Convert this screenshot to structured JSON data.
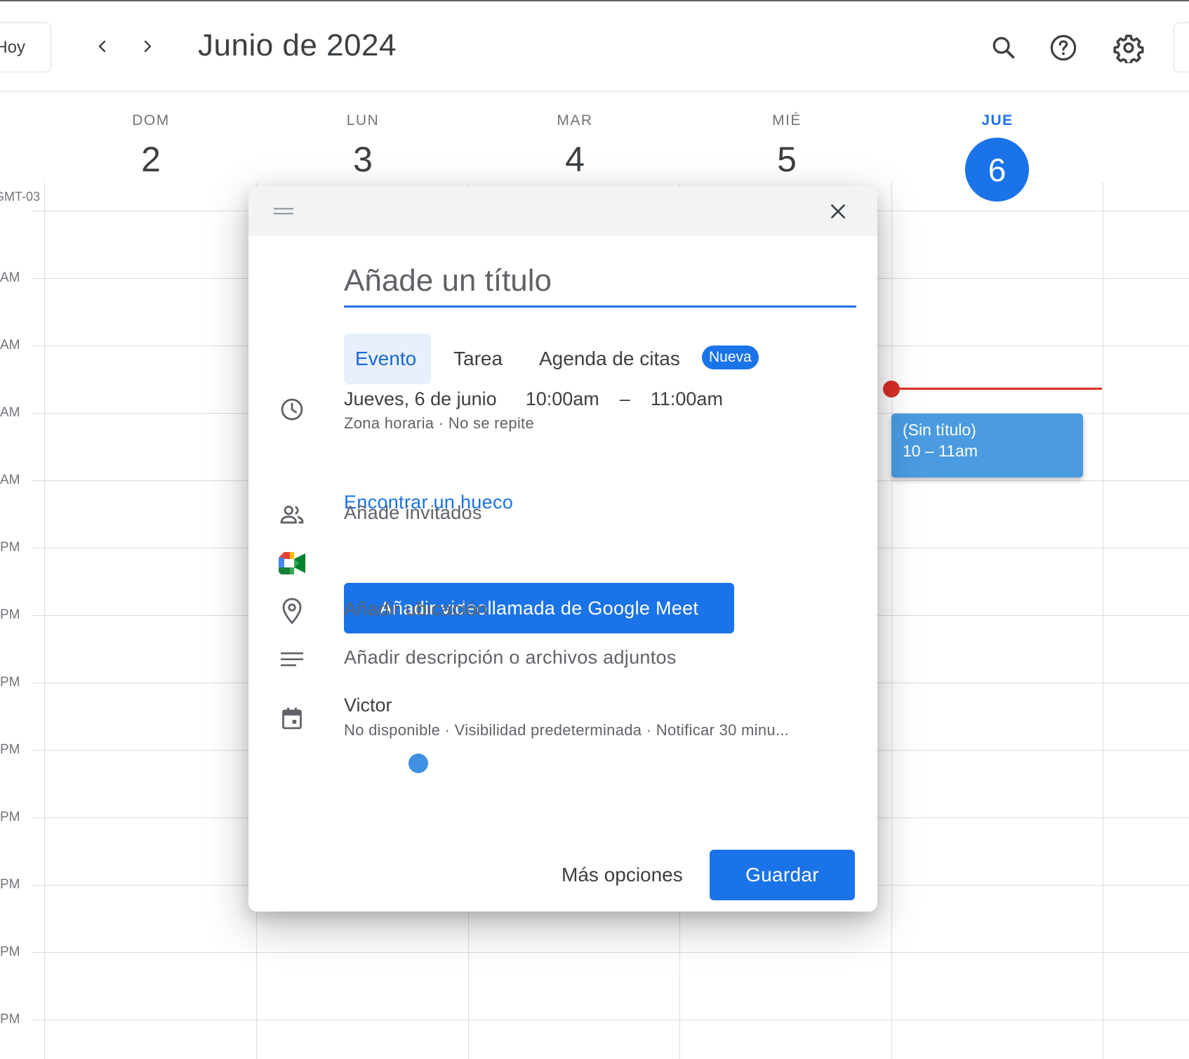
{
  "header": {
    "today_label": "Hoy",
    "month_title": "Junio de 2024",
    "icons": [
      "chevron-left-icon",
      "chevron-right-icon",
      "search-icon",
      "help-icon",
      "gear-icon"
    ]
  },
  "week": {
    "timezone_label": "GMT-03",
    "days": [
      {
        "name": "DOM",
        "num": "2"
      },
      {
        "name": "LUN",
        "num": "3"
      },
      {
        "name": "MAR",
        "num": "4"
      },
      {
        "name": "MIÉ",
        "num": "5"
      },
      {
        "name": "JUE",
        "num": "6"
      }
    ],
    "hour_labels": [
      "AM",
      "AM",
      "AM",
      "AM",
      "AM",
      "PM",
      "PM",
      "PM",
      "PM",
      "PM",
      "PM",
      "PM",
      "PM"
    ]
  },
  "event_chip": {
    "title": "(Sin título)",
    "time": "10 – 11am"
  },
  "dialog": {
    "title_placeholder": "Añade un título",
    "tabs": {
      "evento": "Evento",
      "tarea": "Tarea",
      "agenda": "Agenda de citas",
      "badge": "Nueva"
    },
    "datetime": {
      "date": "Jueves, 6 de junio",
      "start": "10:00am",
      "dash": "–",
      "end": "11:00am",
      "sub": "Zona horaria · No se repite"
    },
    "find_slot": "Encontrar un hueco",
    "guests": "Añade invitados",
    "meet": "Añadir videollamada de Google Meet",
    "location": "Añadir ubicación",
    "description": "Añadir descripción o archivos adjuntos",
    "calendar": {
      "owner": "Victor",
      "details": "No disponible · Visibilidad predeterminada · Notificar 30 minu..."
    },
    "more_options": "Más opciones",
    "save": "Guardar"
  },
  "colors": {
    "accent": "#1a73e8",
    "now_line": "#d93025",
    "event_chip": "#4a9be0",
    "calendar_dot": "#3f91e2"
  }
}
